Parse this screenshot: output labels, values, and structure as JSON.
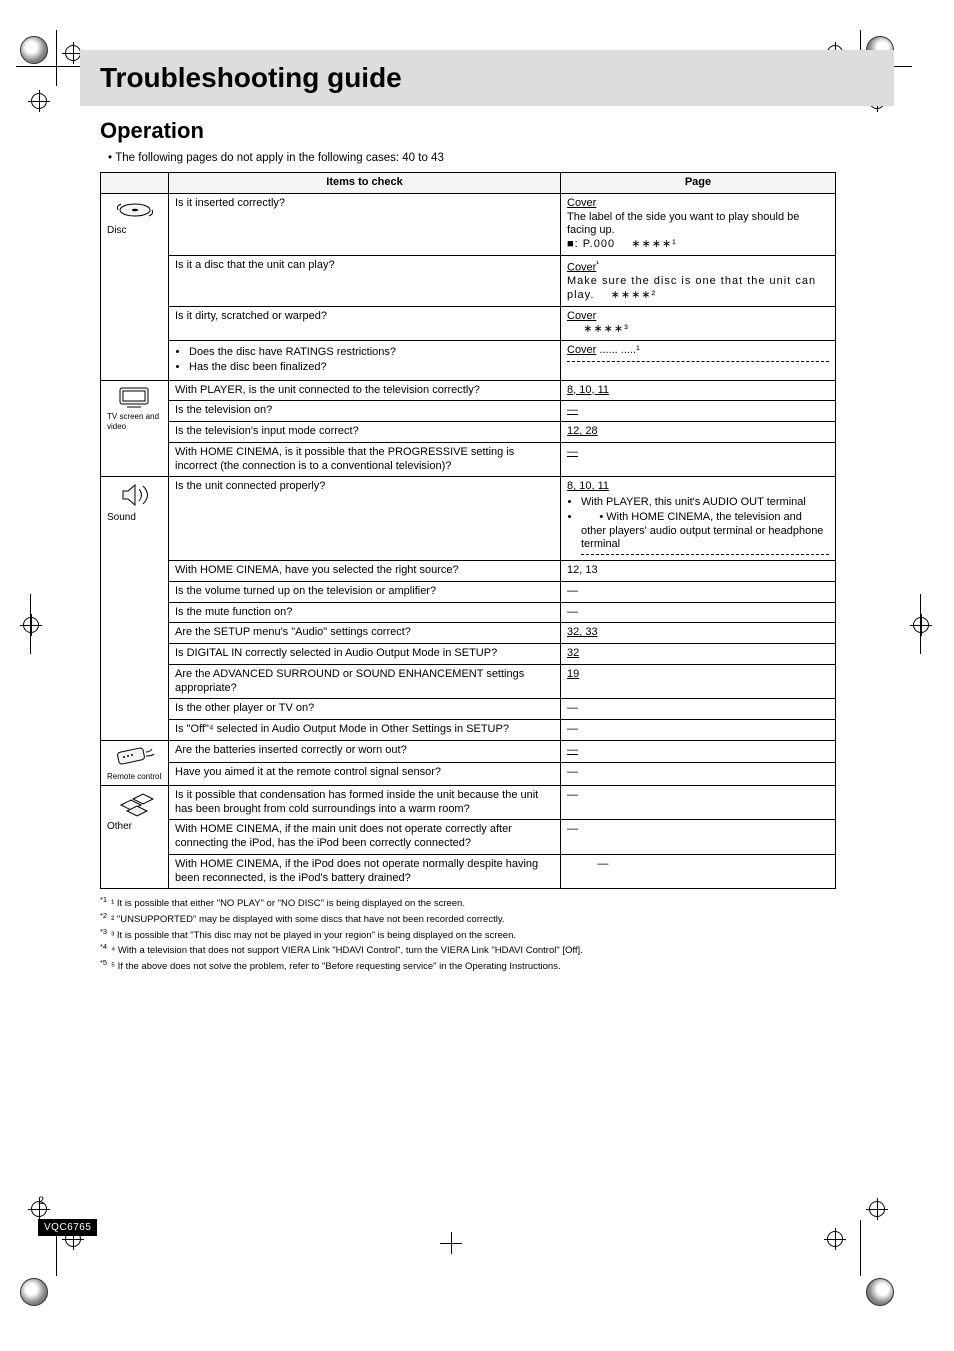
{
  "title": "Troubleshooting guide",
  "subtitle": "Operation",
  "leadBullet": "The following pages do not apply in the following cases: 40 to 43",
  "headers": {
    "itemsToCheck": "Items to check",
    "page": "Page"
  },
  "categories": {
    "disc": "Disc",
    "tv": "TV screen and video",
    "sound": "Sound",
    "remote": "Remote control",
    "other": "Other"
  },
  "rows": {
    "disc": [
      {
        "left": "Is it inserted correctly?",
        "right_u": "Cover",
        "right_rest": "The label of the side you want to play should be facing up.",
        "extra_right": "■: P.000    ∗∗∗∗¹"
      },
      {
        "left": "Is it a disc that the unit can play?",
        "right_u": "Cover",
        "right_rest": "¹",
        "extra_right": "Make sure the disc is one that the unit can play.    ∗∗∗∗²"
      },
      {
        "left": "Is it dirty, scratched or warped?",
        "right_u": "Cover",
        "right_rest": "",
        "extra_right": "    ∗∗∗∗³"
      },
      {
        "left_list": [
          "Does the disc have RATINGS restrictions?",
          "Has the disc been finalized?"
        ],
        "right_u": "Cover",
        "right_rest": " ...... .....¹",
        "dashed": true
      }
    ],
    "tv": [
      {
        "left": "With PLAYER, is the unit connected to the television correctly?",
        "right": "8, 10, 11"
      },
      {
        "left": "Is the television on?",
        "right": "—"
      },
      {
        "left": "Is the television's input mode correct?",
        "right": "12, 28"
      },
      {
        "left": "With HOME CINEMA, is it possible that the PROGRESSIVE setting is incorrect (the connection is to a conventional television)?",
        "right": "—"
      }
    ],
    "sound": [
      {
        "left": "Is the unit connected properly?",
        "right_u": "8, 10, 11",
        "right_list": [
          "With PLAYER, this unit's AUDIO OUT terminal",
          "      • With HOME CINEMA, the television and other players' audio output terminal or headphone terminal"
        ],
        "dashed": true
      },
      {
        "left": "With HOME CINEMA, have you selected the right source?",
        "right": "12, 13"
      },
      {
        "left": "Is the volume turned up on the television or amplifier?",
        "right": "—"
      },
      {
        "left": "Is the mute function on?",
        "right": "—"
      },
      {
        "left": "Are the SETUP menu's \"Audio\" settings correct?",
        "right": "32, 33"
      },
      {
        "left": "Is DIGITAL IN correctly selected in Audio Output Mode in SETUP?",
        "right": "32"
      },
      {
        "left": "Are the ADVANCED SURROUND or SOUND ENHANCEMENT settings appropriate?",
        "right": "19"
      },
      {
        "left": "Is the other player or TV on?",
        "right": "—"
      },
      {
        "left": "Is \"Off\"⁴ selected in Audio Output Mode in Other Settings in SETUP?",
        "right": "—"
      }
    ],
    "remote": [
      {
        "left": "Are the batteries inserted correctly or worn out?",
        "right": "—"
      },
      {
        "left": "Have you aimed it at the remote control signal sensor?",
        "right": "—"
      }
    ],
    "other": [
      {
        "left": "Is it possible that condensation has formed inside the unit because the unit has been brought from cold surroundings into a warm room?",
        "right": "—"
      },
      {
        "left": "With HOME CINEMA, if the main unit does not operate correctly after connecting the iPod, has the iPod been correctly connected?",
        "right": "—"
      },
      {
        "left": "With HOME CINEMA, if the iPod does not operate normally despite having been reconnected, is the iPod's battery drained?",
        "right": "          —"
      }
    ]
  },
  "footnotes": [
    "¹ It is possible that either \"NO PLAY\" or \"NO DISC\" is being displayed on the screen.",
    "² \"UNSUPPORTED\" may be displayed with some discs that have not been recorded correctly.",
    "³ It is possible that \"This disc may not be played in your region\" is being displayed on the screen.",
    "⁴ With a television that does not support VIERA Link \"HDAVI Control\", turn the VIERA Link \"HDAVI Control\" [Off].",
    "⁵ If the above does not solve the problem, refer to \"Before requesting service\" in the Operating Instructions."
  ],
  "pageNumber": "2",
  "sheetLabel": "VQC6765"
}
